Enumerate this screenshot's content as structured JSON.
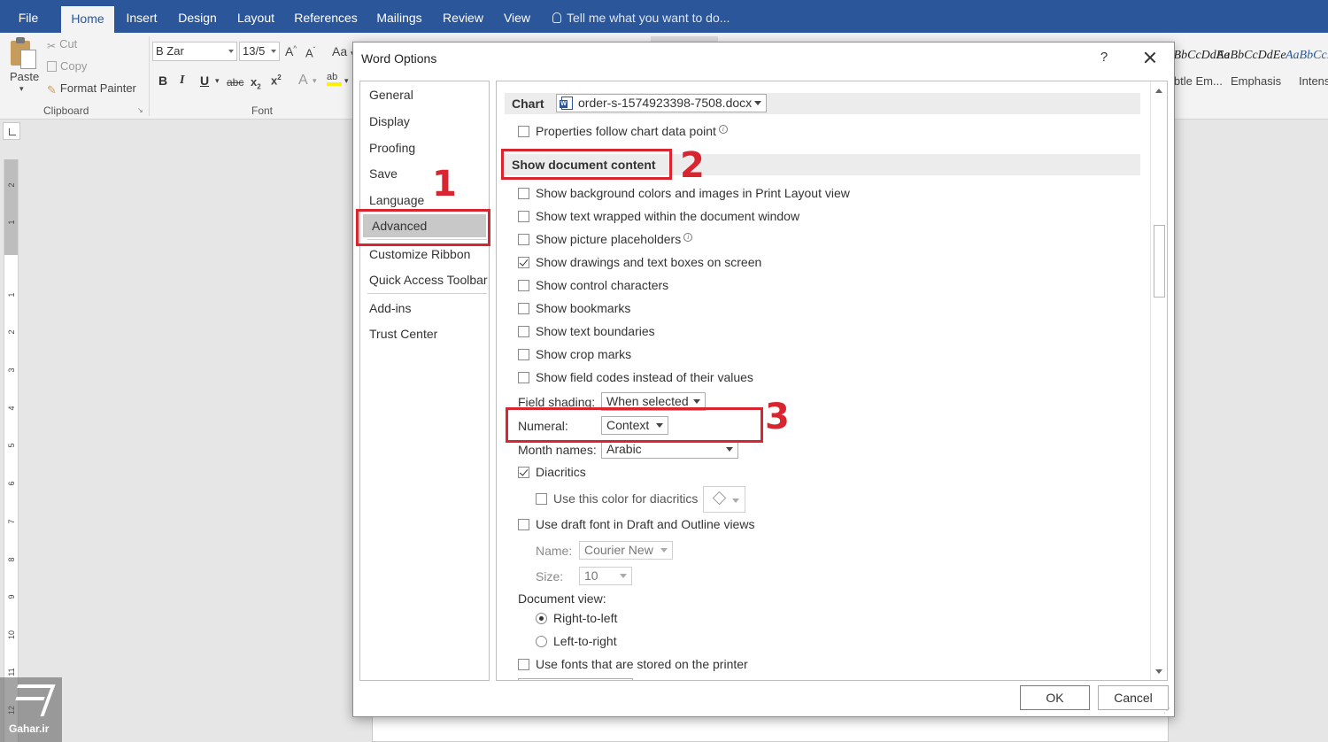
{
  "ribbon": {
    "tabs": [
      "File",
      "Home",
      "Insert",
      "Design",
      "Layout",
      "References",
      "Mailings",
      "Review",
      "View"
    ],
    "active_tab": "Home",
    "tell_me": "Tell me what you want to do...",
    "clipboard": {
      "paste": "Paste",
      "cut": "Cut",
      "copy": "Copy",
      "format_painter": "Format Painter",
      "group_label": "Clipboard"
    },
    "font": {
      "font_name": "B Zar",
      "font_size": "13/5",
      "case": "Aa",
      "group_label": "Font"
    },
    "styles": [
      {
        "preview": "AaBbCcDdEe",
        "name": "Subtle Em..."
      },
      {
        "preview": "AaBbCcDdEe",
        "name": "Emphasis"
      },
      {
        "preview": "AaBbCcDdEe",
        "name": "Intense"
      }
    ]
  },
  "ruler": {
    "labels": [
      "2",
      "1",
      "1",
      "2",
      "3",
      "4",
      "5",
      "6",
      "7",
      "8",
      "9",
      "10",
      "11",
      "12"
    ]
  },
  "watermark": {
    "text": "Gahar.ir"
  },
  "dialog": {
    "title": "Word Options",
    "help": "?",
    "nav": {
      "items": [
        "General",
        "Display",
        "Proofing",
        "Save",
        "Language",
        "Advanced",
        "Customize Ribbon",
        "Quick Access Toolbar",
        "Add-ins",
        "Trust Center"
      ],
      "selected": "Advanced"
    },
    "chart": {
      "label": "Chart",
      "document": "order-s-1574923398-7508.docx",
      "properties_follow": "Properties follow chart data point"
    },
    "show_document_content": {
      "heading": "Show document content",
      "options": [
        {
          "label": "Show background colors and images in Print Layout view",
          "checked": false
        },
        {
          "label": "Show text wrapped within the document window",
          "checked": false
        },
        {
          "label": "Show picture placeholders",
          "checked": false
        },
        {
          "label": "Show drawings and text boxes on screen",
          "checked": true
        },
        {
          "label": "Show control characters",
          "checked": false
        },
        {
          "label": "Show bookmarks",
          "checked": false
        },
        {
          "label": "Show text boundaries",
          "checked": false
        },
        {
          "label": "Show crop marks",
          "checked": false
        },
        {
          "label": "Show field codes instead of their values",
          "checked": false
        }
      ],
      "field_shading_label": "Field shading:",
      "field_shading_value": "When selected",
      "numeral_label": "Numeral:",
      "numeral_value": "Context",
      "month_names_label": "Month names:",
      "month_names_value": "Arabic",
      "diacritics": "Diacritics",
      "use_color_diacritics": "Use this color for diacritics",
      "draft_font": "Use draft font in Draft and Outline views",
      "name_label": "Name:",
      "name_value": "Courier New",
      "size_label": "Size:",
      "size_value": "10",
      "document_view_label": "Document view:",
      "right_to_left": "Right-to-left",
      "left_to_right": "Left-to-right",
      "printer_fonts": "Use fonts that are stored on the printer"
    },
    "buttons": {
      "ok": "OK",
      "cancel": "Cancel"
    }
  },
  "annotations": {
    "n1": "1",
    "n2": "2",
    "n3": "3"
  },
  "colors": {
    "accent": "#2b579a",
    "annotation": "#d8252f"
  }
}
